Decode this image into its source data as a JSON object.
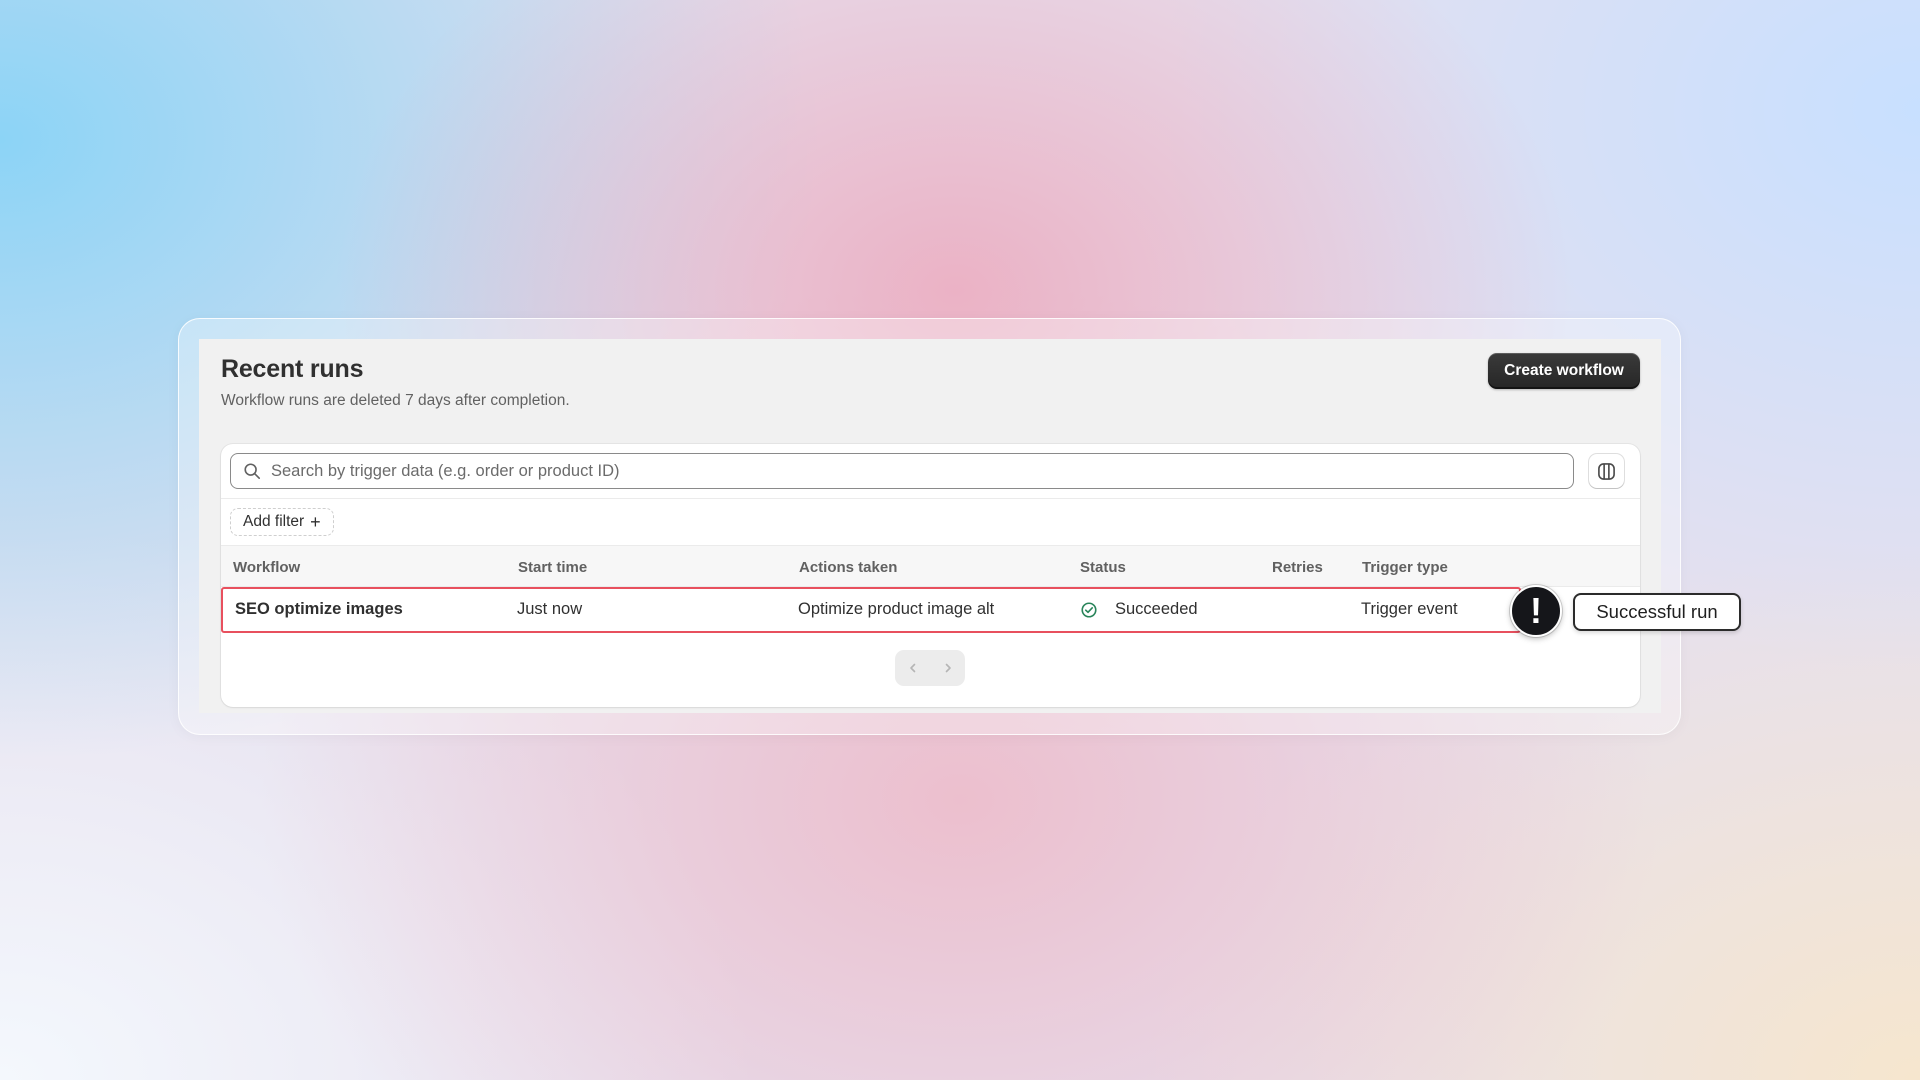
{
  "header": {
    "title": "Recent runs",
    "subtitle": "Workflow runs are deleted 7 days after completion.",
    "create_button_label": "Create workflow"
  },
  "search": {
    "placeholder": "Search by trigger data (e.g. order or product ID)",
    "value": ""
  },
  "filters": {
    "add_filter_label": "Add filter",
    "add_filter_icon": "+"
  },
  "table": {
    "columns": [
      "Workflow",
      "Start time",
      "Actions taken",
      "Status",
      "Retries",
      "Trigger type"
    ],
    "rows": [
      {
        "workflow": "SEO optimize images",
        "start_time": "Just now",
        "actions_taken": "Optimize product image alt",
        "status": "Succeeded",
        "retries": "",
        "trigger_type": "Trigger event"
      }
    ]
  },
  "annotation": {
    "marker_symbol": "!",
    "callout_text": "Successful run",
    "highlight_color": "#e8505e"
  },
  "icons": {
    "search": "search-icon",
    "columns": "columns-icon",
    "status": "check-circle-icon",
    "prev": "chevron-left-icon",
    "next": "chevron-right-icon"
  },
  "colors": {
    "primary_button": "#303030",
    "success": "#29845a",
    "highlight": "#e8505e"
  }
}
